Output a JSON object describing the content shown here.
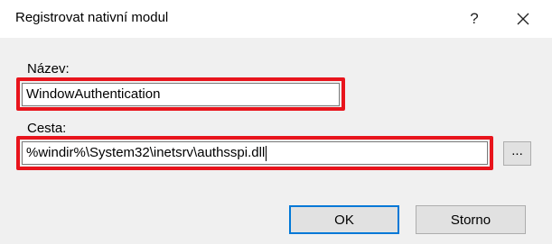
{
  "window": {
    "title": "Registrovat nativní modul",
    "help_label": "?"
  },
  "form": {
    "name_label": "Název:",
    "name_value": "WindowAuthentication",
    "path_label": "Cesta:",
    "path_value": "%windir%\\System32\\inetsrv\\authsspi.dll",
    "browse_label": "..."
  },
  "buttons": {
    "ok_label": "OK",
    "cancel_label": "Storno"
  },
  "colors": {
    "highlight": "#e8141c",
    "accent": "#0078d7"
  },
  "icons": {
    "close": "close-icon"
  }
}
